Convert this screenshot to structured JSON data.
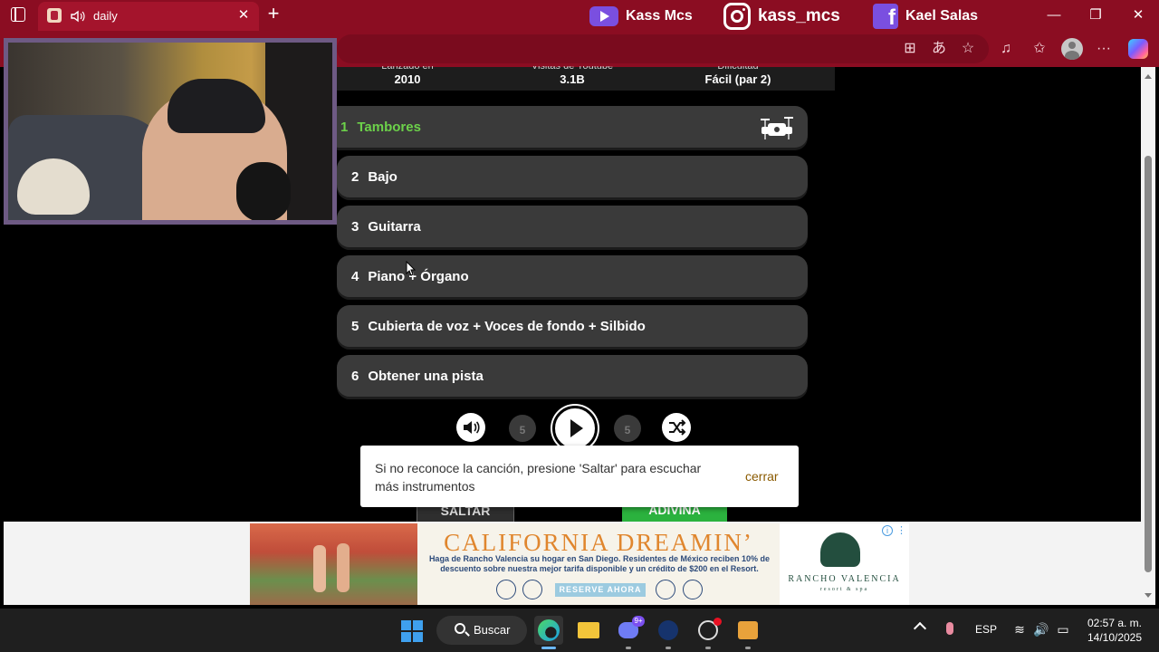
{
  "browser": {
    "tab_title": "daily",
    "tab_close": "✕",
    "new_tab": "+",
    "socials": [
      {
        "name": "Kass Mcs",
        "icon": "youtube-icon"
      },
      {
        "name": "kass_mcs",
        "icon": "instagram-icon"
      },
      {
        "name": "Kael Salas",
        "icon": "facebook-icon"
      }
    ],
    "window_controls": {
      "minimize": "—",
      "maximize": "❐",
      "close": "✕"
    },
    "toolbar_icons": [
      "apps-icon",
      "translate-icon",
      "favorite-icon",
      "music-icon",
      "collections-icon",
      "profile-icon",
      "more-icon",
      "copilot-icon"
    ],
    "toolbar_glyphs": {
      "apps": "⊞",
      "translate": "あ",
      "favorite": "☆",
      "music": "♫",
      "collections": "✩",
      "more": "···"
    }
  },
  "song_info": {
    "released": {
      "label": "Lanzado en",
      "value": "2010"
    },
    "views": {
      "label": "Visitas de Youtube",
      "value": "3.1B"
    },
    "difficulty": {
      "label": "Dificultad",
      "value": "Fácil (par 2)"
    }
  },
  "tracks": [
    {
      "num": "1",
      "label": "Tambores",
      "active": true
    },
    {
      "num": "2",
      "label": "Bajo"
    },
    {
      "num": "3",
      "label": "Guitarra"
    },
    {
      "num": "4",
      "label": "Piano + Órgano"
    },
    {
      "num": "5",
      "label": "Cubierta de voz + Voces de fondo + Silbido"
    },
    {
      "num": "6",
      "label": "Obtener una pista"
    }
  ],
  "controls": {
    "skip_back": "5",
    "skip_forward": "5"
  },
  "buttons": {
    "skip": "SALTAR",
    "guess": "ADIVINA"
  },
  "toast": {
    "message": "Si no reconoce la canción, presione 'Saltar' para escuchar más instrumentos",
    "close": "cerrar"
  },
  "ad": {
    "headline": "CALIFORNIA DREAMIN’",
    "body": "Haga de Rancho Valencia su hogar en San Diego. Residentes de México reciben 10% de descuento sobre nuestra mejor tarifa disponible y un crédito de $200 en el Resort.",
    "cta": "RESERVE AHORA",
    "brand": "RANCHO VALENCIA",
    "brand_sub": "resort & spa",
    "info": "i",
    "menu": "⋮"
  },
  "taskbar": {
    "search": "Buscar",
    "discord_badge": "9+",
    "language": "ESP",
    "time": "02:57 a. m.",
    "date": "14/10/2025",
    "tray_glyphs": {
      "wifi": "≋",
      "volume": "🔊",
      "battery": "▭"
    }
  },
  "colors": {
    "browser_frame": "#8b0d22",
    "active_track": "#6cd14a",
    "track_bg": "#3a3a3a",
    "guess_green": "#2bb23e",
    "webcam_border": "#6e5a84"
  }
}
